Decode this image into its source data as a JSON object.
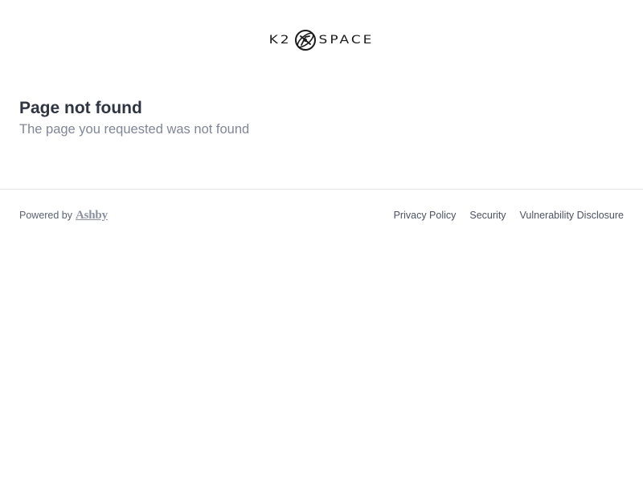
{
  "header": {
    "logo_left": "K2",
    "logo_right": "SPACE",
    "logo_mark_icon": "satellite-orbit-icon"
  },
  "main": {
    "title": "Page not found",
    "subtitle": "The page you requested was not found"
  },
  "footer": {
    "powered_by": "Powered by",
    "brand": "Ashby",
    "links": [
      "Privacy Policy",
      "Security",
      "Vulnerability Disclosure"
    ]
  },
  "colors": {
    "title": "#2f3542",
    "subtitle": "#7f8697",
    "divider": "#e5e7eb",
    "link": "#4b5263",
    "brand": "#8a91a0"
  }
}
